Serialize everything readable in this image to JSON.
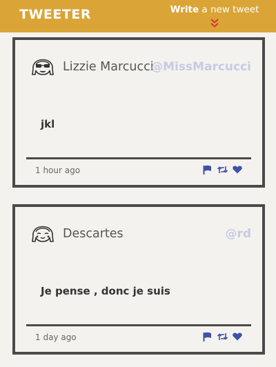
{
  "header": {
    "brand": "TWEETER",
    "write_bold": "Write",
    "write_rest": " a new tweet",
    "toggle_icon": "double-chevron-down-icon",
    "bg_color": "#daa436"
  },
  "tweets": [
    {
      "name": "Lizzie Marcucci",
      "handle": "@MissMarcucci",
      "text": "jkl",
      "time": "1 hour ago",
      "avatar_icon": "sunglasses-avatar-icon"
    },
    {
      "name": "Descartes",
      "handle": "@rd",
      "text": "Je pense , donc je suis",
      "time": "1 day ago",
      "avatar_icon": "smiling-avatar-icon"
    }
  ],
  "actions": [
    "flag-icon",
    "retweet-icon",
    "heart-icon"
  ],
  "colors": {
    "action": "#3f51a8",
    "handle": "#c7cbe3",
    "border": "#4a4a4a"
  }
}
